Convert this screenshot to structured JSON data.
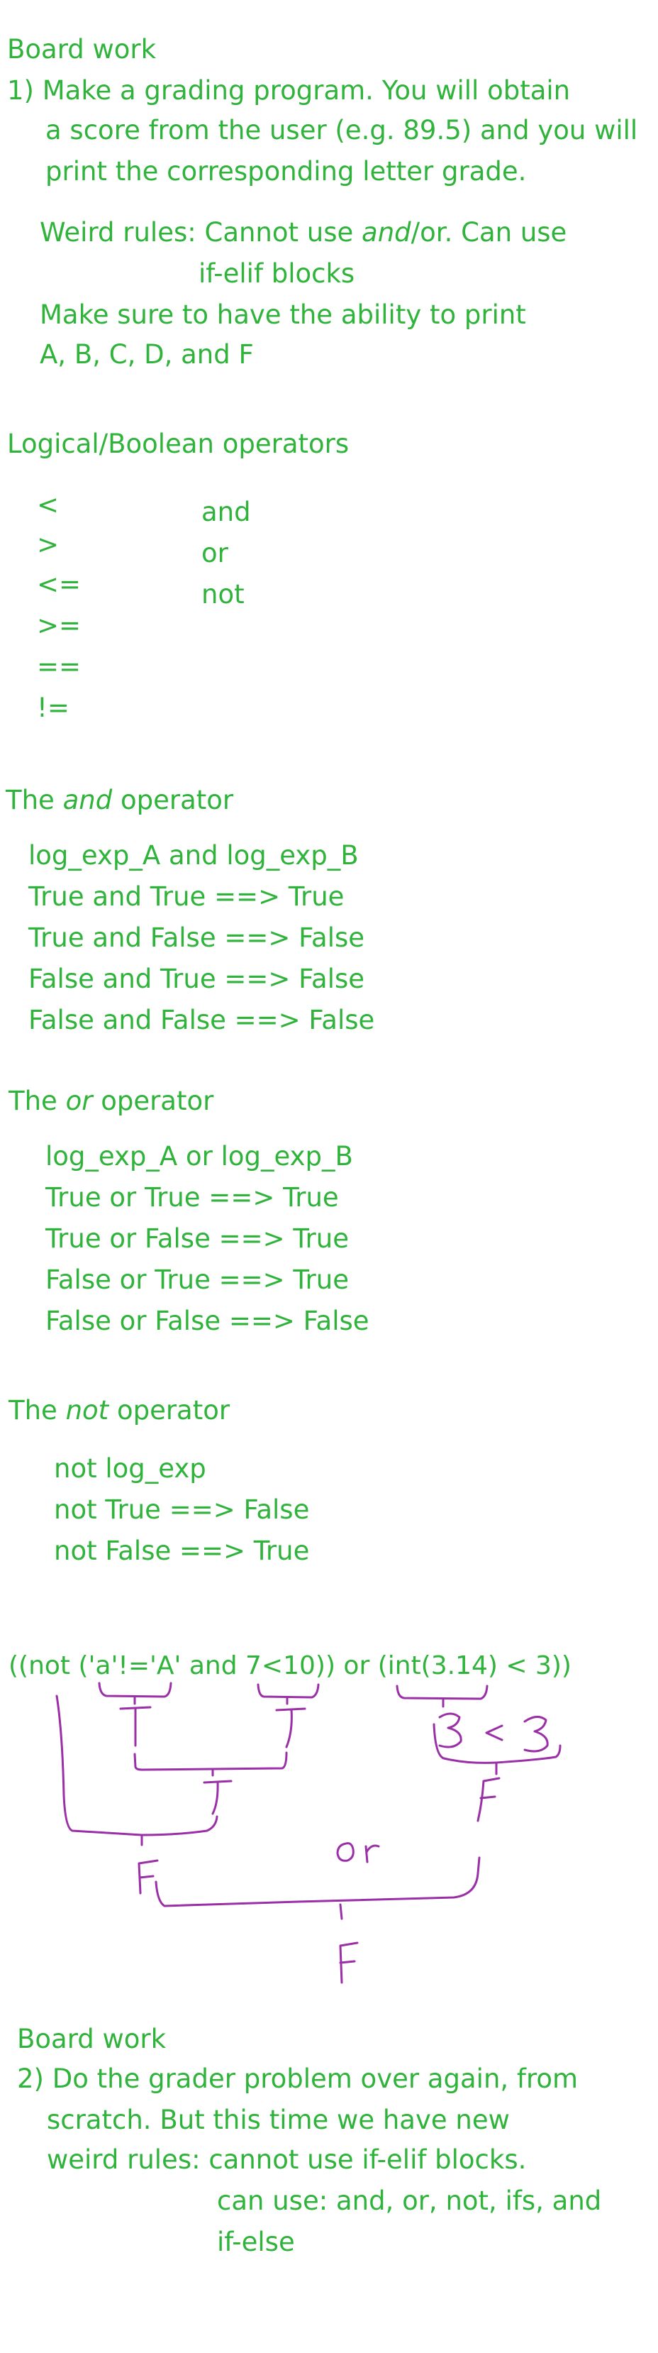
{
  "colors": {
    "text": "#2fb33b",
    "ink": "#9b2fa8",
    "background": "#ffffff"
  },
  "board1": {
    "title": "Board work",
    "line1": "1) Make a grading program. You will obtain",
    "line2": "a score from the user (e.g. 89.5) and you will",
    "line3": "print the corresponding letter grade.",
    "rules_pre": "Weird rules: Cannot use ",
    "rules_and": "and",
    "rules_post": "/or. Can use",
    "rules_line2": "if-elif blocks",
    "ensure1": "Make sure to have the ability to print",
    "ensure2": "A, B, C, D, and F"
  },
  "operators": {
    "title": "Logical/Boolean operators",
    "comparison": [
      "<",
      ">",
      "<=",
      ">=",
      "==",
      "!="
    ],
    "logical": [
      "and",
      "or",
      "not"
    ]
  },
  "and_section": {
    "title_pre": "The ",
    "title_em": "and",
    "title_post": " operator",
    "lines": [
      "log_exp_A  and  log_exp_B",
      "True and True  ==> True",
      "True and False ==> False",
      "False and True ==> False",
      "False and False ==> False"
    ]
  },
  "or_section": {
    "title_pre": "The ",
    "title_em": "or",
    "title_post": " operator",
    "lines": [
      "log_exp_A or log_exp_B",
      "True or True ==> True",
      "True or False ==> True",
      "False or True ==> True",
      "False or False ==> False"
    ]
  },
  "not_section": {
    "title_pre": "The ",
    "title_em": "not",
    "title_post": " operator",
    "lines": [
      "not log_exp",
      "not True ==> False",
      "not False ==> True"
    ]
  },
  "expression": {
    "text": "((not ('a'!='A' and 7<10)) or (int(3.14) < 3))",
    "annotations": {
      "t1": "T",
      "t2": "T",
      "int_result": "3",
      "lt": "<",
      "three": "3",
      "t_combined": "T",
      "f_right": "F",
      "f_left": "F",
      "or_label": "or",
      "f_final": "F"
    }
  },
  "board2": {
    "title": "Board work",
    "line1": "2) Do the grader problem over again, from",
    "line2": "scratch. But this time we have new",
    "line3": "weird rules: cannot use if-elif blocks.",
    "line4": "can use: and, or, not, ifs, and",
    "line5": "if-else"
  }
}
